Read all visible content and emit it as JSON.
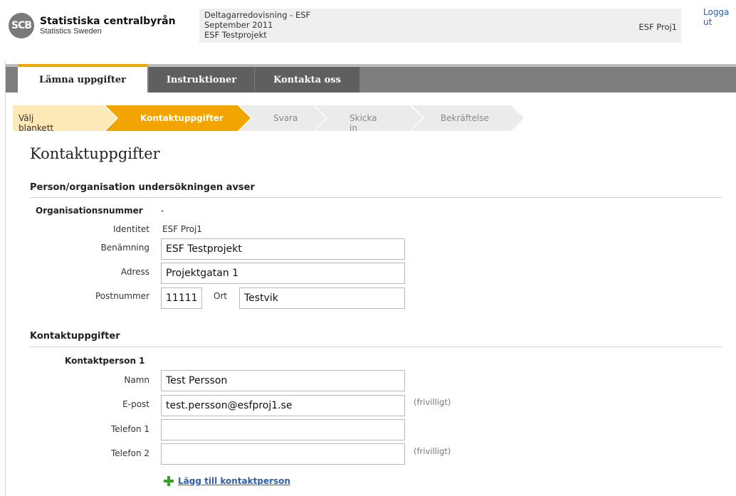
{
  "header": {
    "logo_mark": "SCB",
    "logo_name": "Statistiska centralbyrån",
    "logo_sub": "Statistics Sweden",
    "info_line1": "Deltagarredovisning - ESF",
    "info_line2": "September 2011",
    "info_line3": "ESF Testprojekt",
    "info_right": "ESF Proj1",
    "logout": "Logga ut"
  },
  "tabs": [
    "Lämna uppgifter",
    "Instruktioner",
    "Kontakta oss"
  ],
  "steps": [
    "Välj blankett",
    "Kontaktuppgifter",
    "Svara",
    "Skicka in",
    "Bekräftelse"
  ],
  "page_title": "Kontaktuppgifter",
  "org_section": {
    "heading": "Person/organisation undersökningen avser",
    "orgnr_label": "Organisationsnummer",
    "orgnr_value": "-",
    "identitet_label": "Identitet",
    "identitet_value": "ESF Proj1",
    "benamning_label": "Benämning",
    "benamning_value": "ESF Testprojekt",
    "adress_label": "Adress",
    "adress_value": "Projektgatan 1",
    "postnr_label": "Postnummer",
    "postnr_value": "11111",
    "ort_label": "Ort",
    "ort_value": "Testvik"
  },
  "contact_section": {
    "heading": "Kontaktuppgifter",
    "person_label": "Kontaktperson 1",
    "namn_label": "Namn",
    "namn_value": "Test Persson",
    "epost_label": "E-post",
    "epost_value": "test.persson@esfproj1.se",
    "optional": "(frivilligt)",
    "tel1_label": "Telefon 1",
    "tel1_value": "",
    "tel2_label": "Telefon 2",
    "tel2_value": "",
    "add_link": "Lägg till kontaktperson"
  },
  "colors": {
    "accent": "#f2a400",
    "step_done": "#fde9b8",
    "step_todo": "#ebebeb",
    "link": "#2e5fa8"
  }
}
